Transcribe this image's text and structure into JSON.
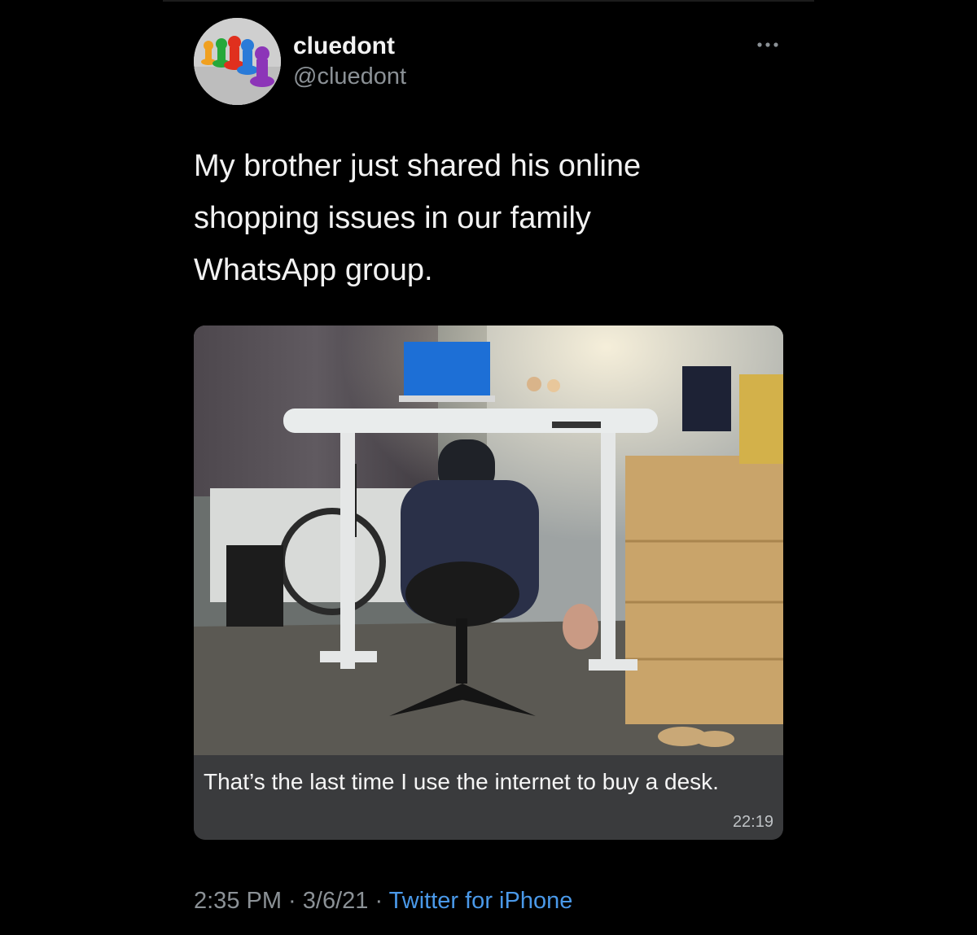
{
  "user": {
    "display_name": "cluedont",
    "handle": "@cluedont",
    "avatar_icon": "avatar-game-pieces-icon"
  },
  "tweet": {
    "text": "My brother just shared his online\nshopping issues in our family\nWhatsApp group.",
    "more_icon": "more-options-icon"
  },
  "media": {
    "caption": "That’s the last time I use the internet to buy a desk.",
    "caption_time": "22:19"
  },
  "footer": {
    "time": "2:35 PM",
    "sep1": " · ",
    "date": "3/6/21",
    "sep2": " · ",
    "source": "Twitter for iPhone"
  },
  "colors": {
    "background": "#000000",
    "link": "#4a99e9",
    "secondary_text": "#8b9196"
  }
}
